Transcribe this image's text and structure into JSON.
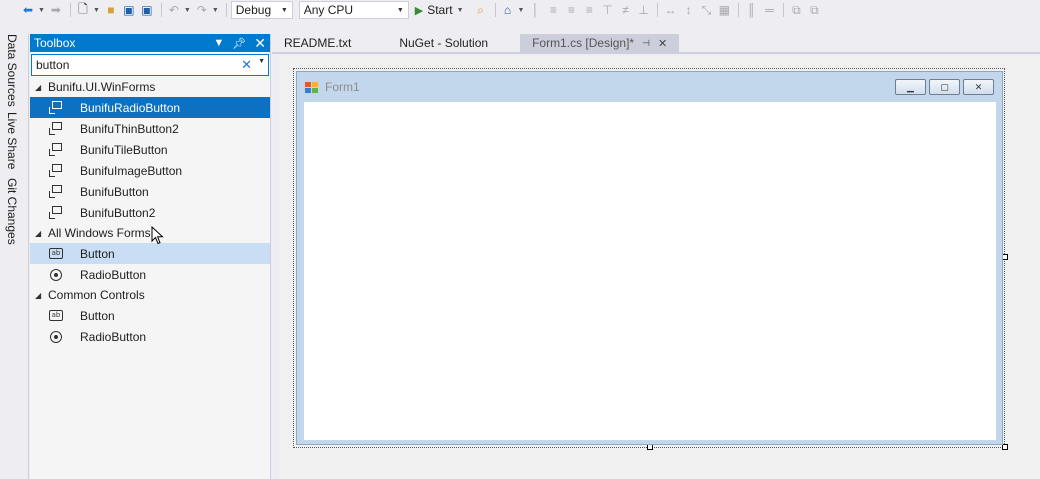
{
  "toolbar": {
    "config": "Debug",
    "platform": "Any CPU",
    "start_label": "Start"
  },
  "side_tabs": [
    "Data Sources",
    "Live Share",
    "Git Changes"
  ],
  "toolbox": {
    "title": "Toolbox",
    "search_value": "button",
    "groups": [
      {
        "label": "Bunifu.UI.WinForms",
        "items": [
          "BunifuRadioButton",
          "BunifuThinButton2",
          "BunifuTileButton",
          "BunifuImageButton",
          "BunifuButton",
          "BunifuButton2"
        ]
      },
      {
        "label": "All Windows Forms",
        "items": [
          "Button",
          "RadioButton"
        ]
      },
      {
        "label": "Common Controls",
        "items": [
          "Button",
          "RadioButton"
        ]
      }
    ]
  },
  "doc_tabs": [
    "README.txt",
    "NuGet - Solution",
    "Form1.cs [Design]*"
  ],
  "form": {
    "title": "Form1"
  },
  "colors": {
    "accent": "#007acc",
    "selected": "#0e70c0",
    "hover": "#c9def5"
  }
}
